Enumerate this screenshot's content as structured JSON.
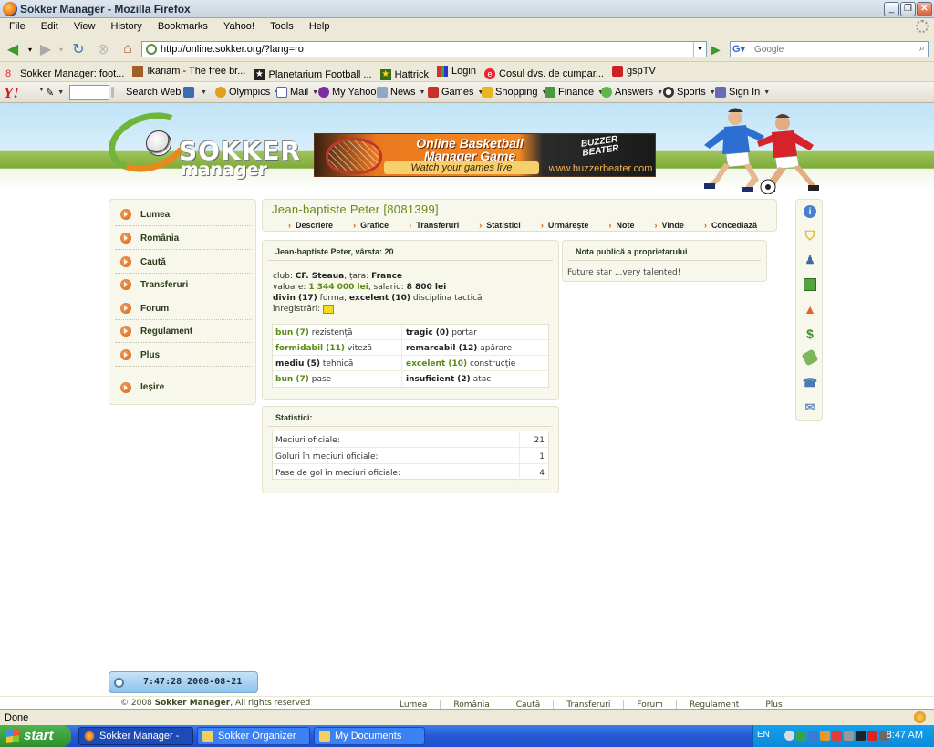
{
  "window": {
    "title": "Sokker Manager - Mozilla Firefox"
  },
  "menu": [
    "File",
    "Edit",
    "View",
    "History",
    "Bookmarks",
    "Yahoo!",
    "Tools",
    "Help"
  ],
  "address": {
    "url": "http://online.sokker.org/?lang=ro",
    "search_placeholder": "Google"
  },
  "bookmarks": [
    "Sokker Manager: foot...",
    "Ikariam - The free br...",
    "Planetarium Football ...",
    "Hattrick",
    "Login",
    "Cosul dvs. de cumpar...",
    "gspTV"
  ],
  "yahoo_toolbar": {
    "search_label": "Search Web",
    "items": [
      "Olympics",
      "Mail",
      "My Yahoo!",
      "News",
      "Games",
      "Shopping",
      "Finance",
      "Answers",
      "Sports",
      "Sign In"
    ]
  },
  "site": {
    "logo_top": "SOKKER",
    "logo_bottom": "manager",
    "banner": {
      "line1": "Online Basketball",
      "line2": "Manager Game",
      "tagline": "Watch your games live",
      "brand": "BUZZER BEATER",
      "url": "www.buzzerbeater.com"
    }
  },
  "left_menu": [
    "Lumea",
    "România",
    "Caută",
    "Transferuri",
    "Forum",
    "Regulament",
    "Plus",
    "Ieșire"
  ],
  "player": {
    "title": "Jean-baptiste Peter [8081399]",
    "tabs": [
      "Descriere",
      "Grafice",
      "Transferuri",
      "Statistici",
      "Urmărește",
      "Note",
      "Vinde",
      "Concediază"
    ],
    "header": "Jean-baptiste Peter, vârsta: 20",
    "club_label": "club:",
    "club": "CF. Steaua",
    "country_label": ", țara:",
    "country": "France",
    "value_label": "valoare:",
    "value": "1 344 000 lei",
    "salary_label": ", salariu:",
    "salary": "8 800 lei",
    "form_level": "divin (17)",
    "form_label": "forma,",
    "discipline_level": "excelent (10)",
    "discipline_label": "disciplina tactică",
    "records_label": "înregistrări:",
    "skills": [
      {
        "level": "bun (7)",
        "name": "rezistență",
        "level2": "tragic (0)",
        "name2": "portar",
        "green1": true,
        "green2": false
      },
      {
        "level": "formidabil (11)",
        "name": "viteză",
        "level2": "remarcabil (12)",
        "name2": "apărare",
        "green1": true,
        "green2": false
      },
      {
        "level": "mediu (5)",
        "name": "tehnică",
        "level2": "excelent (10)",
        "name2": "construcție",
        "green1": false,
        "green2": true
      },
      {
        "level": "bun (7)",
        "name": "pase",
        "level2": "insuficient (2)",
        "name2": "atac",
        "green1": true,
        "green2": false
      }
    ]
  },
  "note": {
    "title": "Nota publică a proprietarului",
    "text": "Future star ...very talented!"
  },
  "stats": {
    "title": "Statistici:",
    "rows": [
      {
        "label": "Meciuri oficiale:",
        "value": "21"
      },
      {
        "label": "Goluri în meciuri oficiale:",
        "value": "1"
      },
      {
        "label": "Pase de gol în meciuri oficiale:",
        "value": "4"
      }
    ]
  },
  "clock": "7:47:28 2008-08-21",
  "footer": {
    "copyright_prefix": "© 2008",
    "copyright_brand": "Sokker Manager",
    "copyright_suffix": ", All rights reserved",
    "links": [
      "Lumea",
      "România",
      "Caută",
      "Transferuri",
      "Forum",
      "Regulament",
      "Plus"
    ]
  },
  "status": "Done",
  "taskbar": {
    "start": "start",
    "tasks": [
      "Sokker Manager - Mo...",
      "Sokker Organizer",
      "My Documents"
    ],
    "lang": "EN",
    "time": "8:47 AM"
  },
  "colors": {
    "accent_green": "#5a8b12",
    "bullet_orange": "#d25e0d",
    "panel_bg": "#f8f7ec"
  }
}
